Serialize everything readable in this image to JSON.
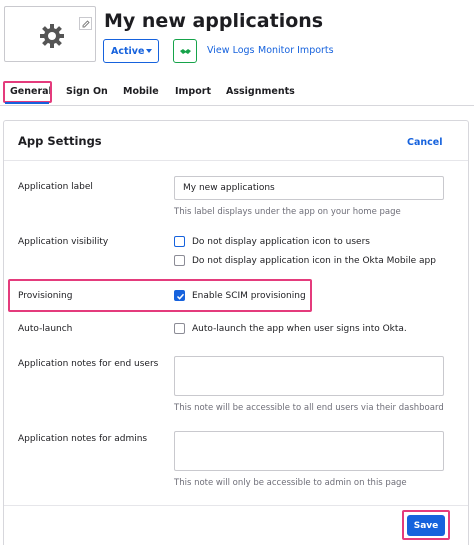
{
  "app": {
    "title": "My new applications",
    "logo_icon": "gear-icon",
    "status_label": "Active",
    "view_logs_label": "View Logs",
    "monitor_imports_label": "Monitor Imports"
  },
  "tabs": [
    {
      "label": "General",
      "selected": true
    },
    {
      "label": "Sign On"
    },
    {
      "label": "Mobile"
    },
    {
      "label": "Import"
    },
    {
      "label": "Assignments"
    }
  ],
  "settings": {
    "title": "App Settings",
    "cancel_label": "Cancel",
    "application_label": {
      "label": "Application label",
      "value": "My new applications",
      "help": "This label displays under the app on your home page"
    },
    "application_visibility": {
      "label": "Application visibility",
      "options": [
        {
          "label": "Do not display application icon to users",
          "checked": false
        },
        {
          "label": "Do not display application icon in the Okta Mobile app",
          "checked": false
        }
      ]
    },
    "provisioning": {
      "label": "Provisioning",
      "option_label": "Enable SCIM provisioning",
      "checked": true
    },
    "auto_launch": {
      "label": "Auto-launch",
      "option_label": "Auto-launch the app when user signs into Okta.",
      "checked": false
    },
    "notes_end_users": {
      "label": "Application notes for end users",
      "help": "This note will be accessible to all end users via their dashboard"
    },
    "notes_admins": {
      "label": "Application notes for admins",
      "help": "This note will only be accessible to admin on this page"
    },
    "save_label": "Save"
  },
  "colors": {
    "primary": "#1662dd",
    "highlight": "#e43b7c",
    "success": "#16a34a"
  }
}
